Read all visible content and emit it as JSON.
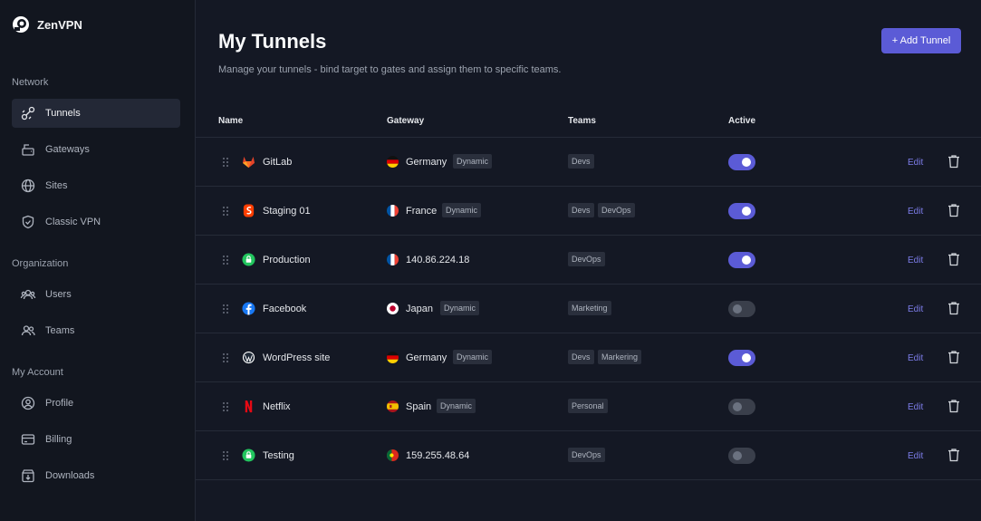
{
  "app": {
    "name": "ZenVPN"
  },
  "sidebar": {
    "sections": [
      {
        "label": "Network",
        "items": [
          {
            "label": "Tunnels",
            "icon": "tunnel-icon",
            "active": true
          },
          {
            "label": "Gateways",
            "icon": "gateway-icon"
          },
          {
            "label": "Sites",
            "icon": "globe-icon"
          },
          {
            "label": "Classic VPN",
            "icon": "shield-icon"
          }
        ]
      },
      {
        "label": "Organization",
        "items": [
          {
            "label": "Users",
            "icon": "users-icon"
          },
          {
            "label": "Teams",
            "icon": "team-icon"
          }
        ]
      },
      {
        "label": "My Account",
        "items": [
          {
            "label": "Profile",
            "icon": "profile-icon"
          },
          {
            "label": "Billing",
            "icon": "credit-card-icon"
          },
          {
            "label": "Downloads",
            "icon": "download-icon"
          }
        ]
      }
    ]
  },
  "header": {
    "title": "My Tunnels",
    "subtitle": "Manage your tunnels - bind target to gates and assign them to specific teams.",
    "add_button": "+ Add Tunnel"
  },
  "table": {
    "columns": {
      "name": "Name",
      "gateway": "Gateway",
      "teams": "Teams",
      "active": "Active"
    },
    "edit_label": "Edit",
    "rows": [
      {
        "name": "GitLab",
        "icon": "gitlab-icon",
        "flag": "germany",
        "gateway": "Germany",
        "gateway_tag": "Dynamic",
        "teams": [
          "Devs"
        ],
        "active": true
      },
      {
        "name": "Staging 01",
        "icon": "svelte-icon",
        "flag": "france",
        "gateway": "France",
        "gateway_tag": "Dynamic",
        "teams": [
          "Devs",
          "DevOps"
        ],
        "active": true
      },
      {
        "name": "Production",
        "icon": "lock-icon",
        "flag": "france",
        "gateway": "140.86.224.18",
        "gateway_tag": "",
        "teams": [
          "DevOps"
        ],
        "active": true
      },
      {
        "name": "Facebook",
        "icon": "facebook-icon",
        "flag": "japan",
        "gateway": "Japan",
        "gateway_tag": "Dynamic",
        "teams": [
          "Marketing"
        ],
        "active": false
      },
      {
        "name": "WordPress site",
        "icon": "wordpress-icon",
        "flag": "germany",
        "gateway": "Germany",
        "gateway_tag": "Dynamic",
        "teams": [
          "Devs",
          "Markering"
        ],
        "active": true
      },
      {
        "name": "Netflix",
        "icon": "netflix-icon",
        "flag": "spain",
        "gateway": "Spain",
        "gateway_tag": "Dynamic",
        "teams": [
          "Personal"
        ],
        "active": false
      },
      {
        "name": "Testing",
        "icon": "lock-icon",
        "flag": "portugal",
        "gateway": "159.255.48.64",
        "gateway_tag": "",
        "teams": [
          "DevOps"
        ],
        "active": false
      }
    ]
  },
  "colors": {
    "accent": "#5b5bd6",
    "background": "#141824",
    "sidebar": "#12161f",
    "edit_link": "#7c7ce8"
  }
}
